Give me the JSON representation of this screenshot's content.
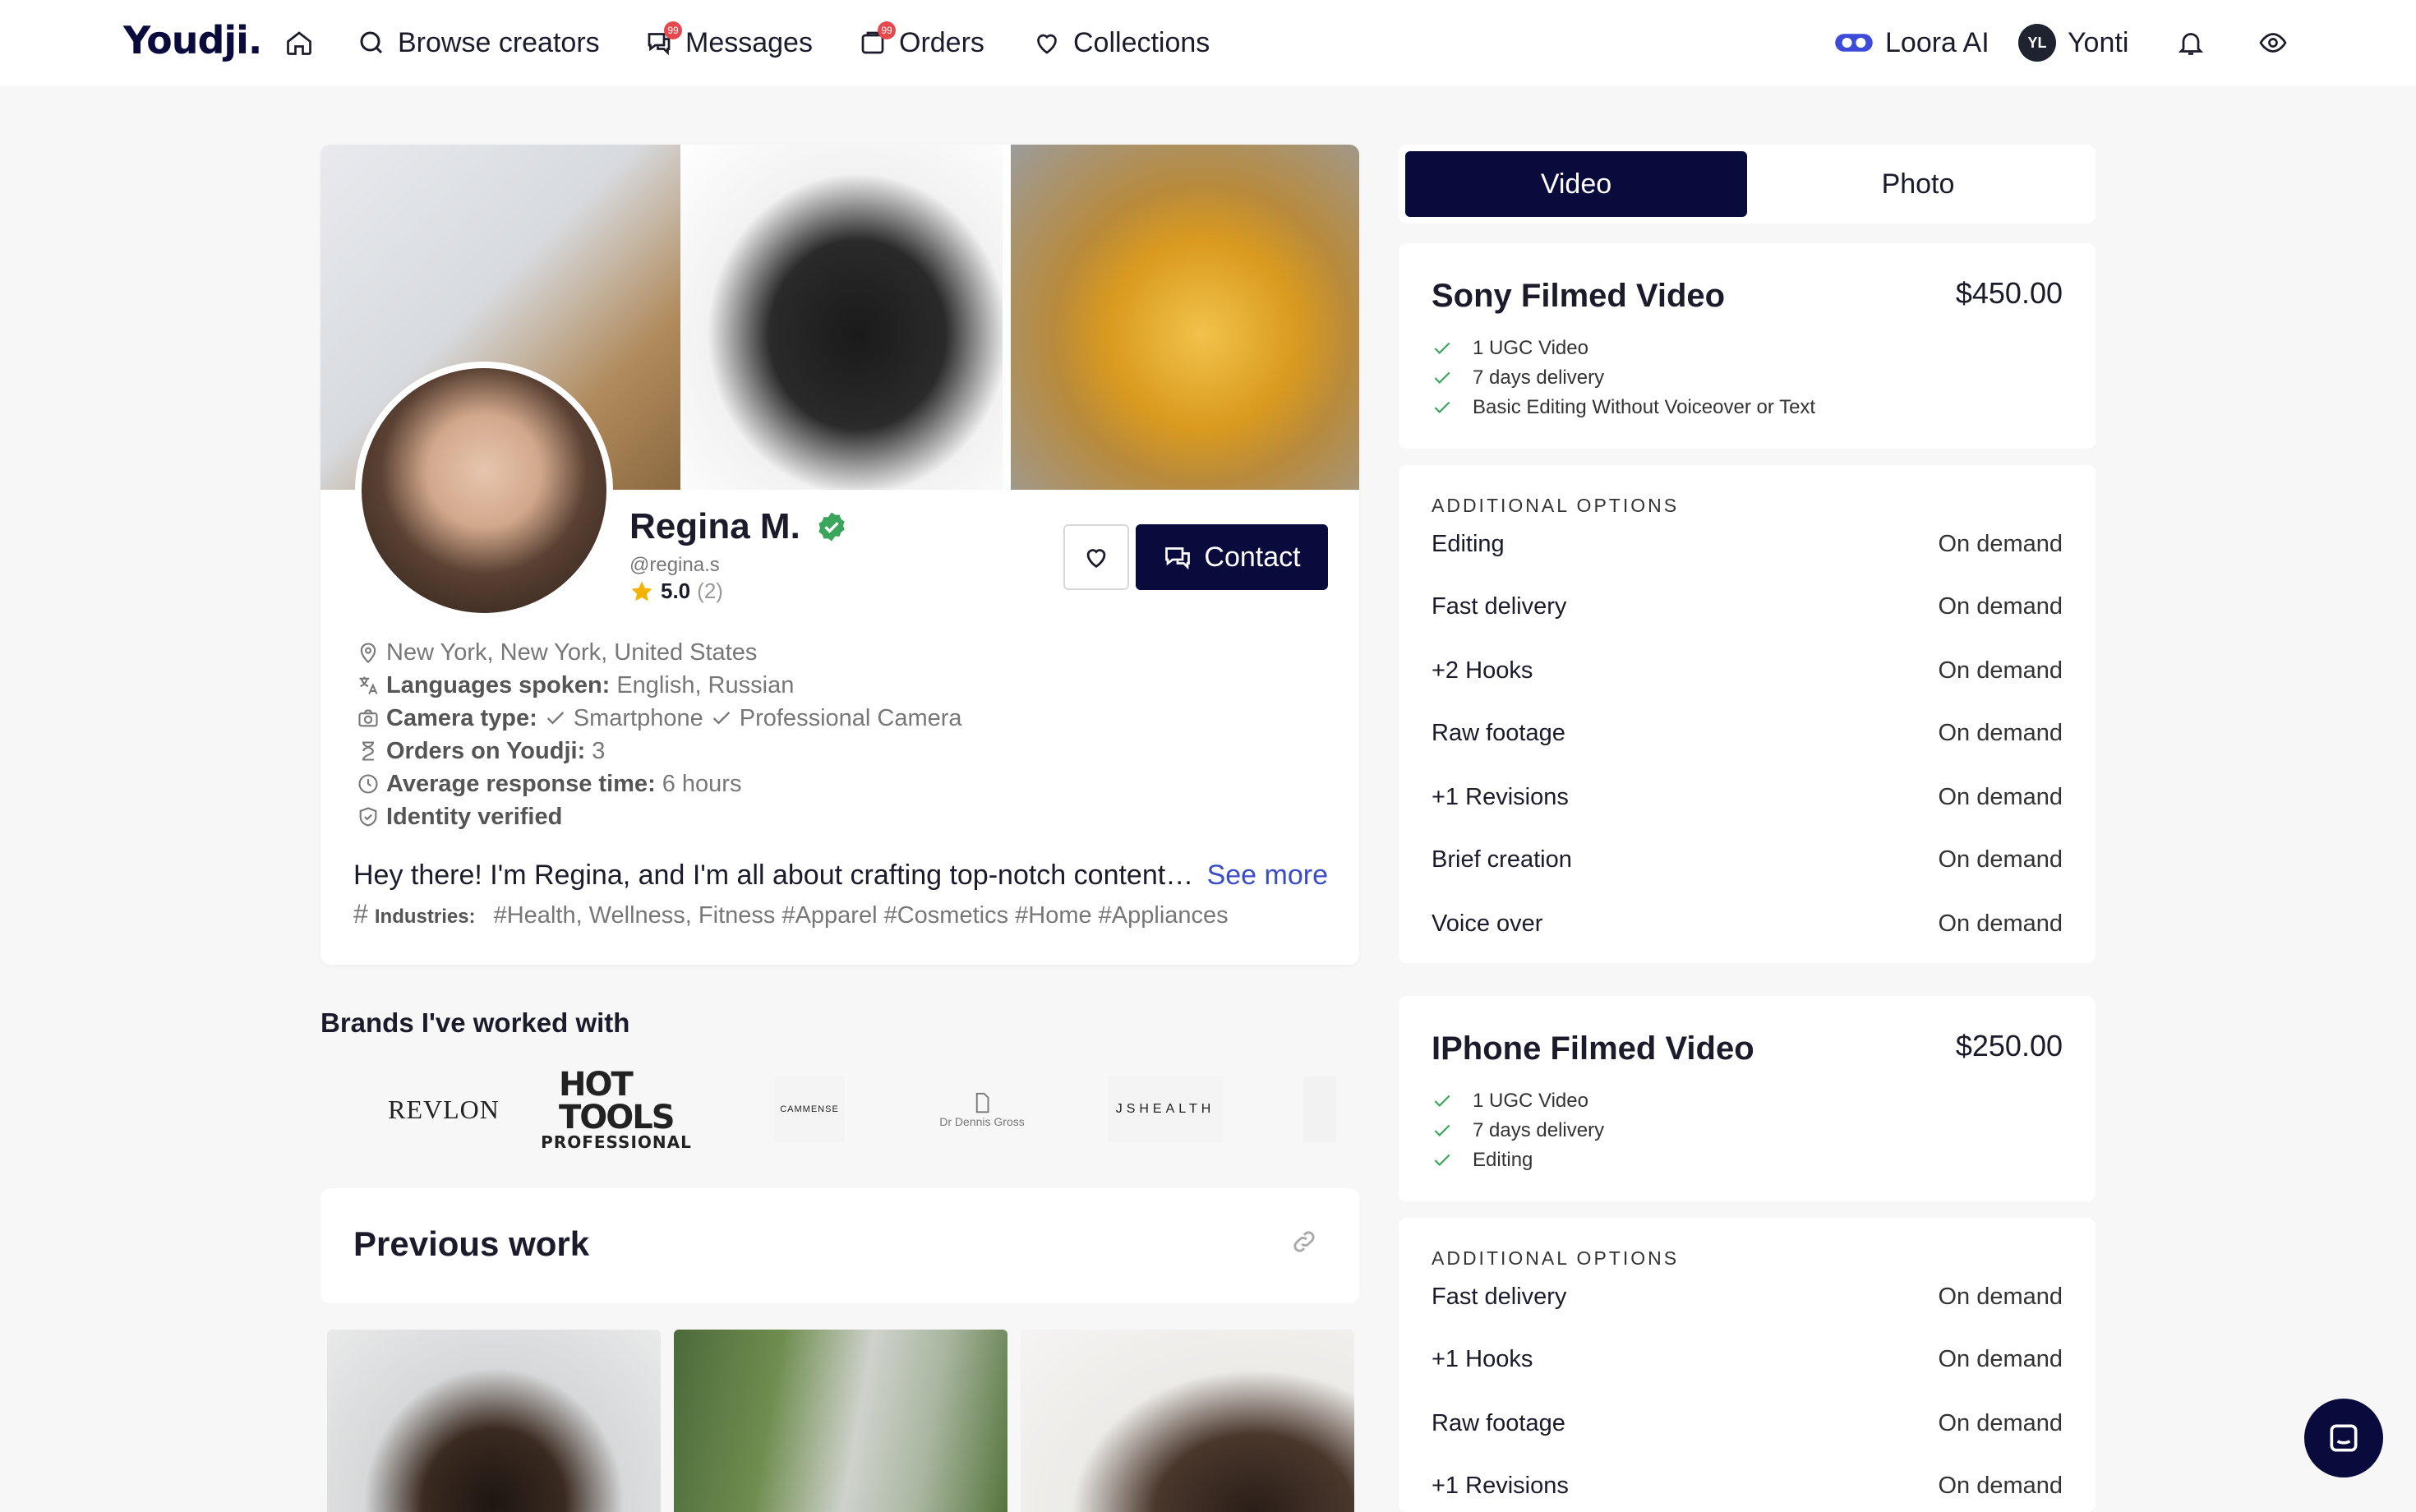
{
  "nav": {
    "logo": "Youdji.",
    "browse": "Browse creators",
    "messages": "Messages",
    "orders": "Orders",
    "collections": "Collections",
    "loora": "Loora AI",
    "user_initials": "YL",
    "user_name": "Yonti",
    "badge_count": "99"
  },
  "profile": {
    "name": "Regina M.",
    "handle": "@regina.s",
    "rating": "5.0",
    "rating_count": "(2)",
    "contact_label": "Contact",
    "location": "New York, New York, United States",
    "languages_label": "Languages spoken:",
    "languages": "English, Russian",
    "camera_label": "Camera type:",
    "camera_1": "Smartphone",
    "camera_2": "Professional Camera",
    "orders_label": "Orders on Youdji:",
    "orders_value": "3",
    "response_label": "Average response time:",
    "response_value": "6 hours",
    "identity": "Identity verified",
    "bio": "Hey there! I'm Regina, and I'm all about crafting top-notch content that tells your story",
    "see_more": "See more",
    "industries_label": "Industries:",
    "industries": "#Health, Wellness, Fitness #Apparel #Cosmetics #Home #Appliances"
  },
  "brands": {
    "title": "Brands I've worked with",
    "revlon": "REVLON",
    "hot_tools_1": "HOT TOOLS",
    "hot_tools_2": "PROFESSIONAL",
    "cammense": "CAMMENSE",
    "dr_dennis": "Dr Dennis Gross",
    "jshealth": "JSHEALTH"
  },
  "previous_work": {
    "title": "Previous work"
  },
  "tabs": {
    "video": "Video",
    "photo": "Photo"
  },
  "packages": [
    {
      "title": "Sony Filmed Video",
      "price": "$450.00",
      "features": [
        "1 UGC Video",
        "7 days delivery",
        "Basic Editing Without Voiceover or Text"
      ],
      "options_header": "ADDITIONAL OPTIONS",
      "options": [
        {
          "name": "Editing",
          "value": "On demand"
        },
        {
          "name": "Fast delivery",
          "value": "On demand"
        },
        {
          "name": "+2 Hooks",
          "value": "On demand"
        },
        {
          "name": "Raw footage",
          "value": "On demand"
        },
        {
          "name": "+1 Revisions",
          "value": "On demand"
        },
        {
          "name": "Brief creation",
          "value": "On demand"
        },
        {
          "name": "Voice over",
          "value": "On demand"
        }
      ]
    },
    {
      "title": "IPhone Filmed Video",
      "price": "$250.00",
      "features": [
        "1 UGC Video",
        "7 days delivery",
        "Editing"
      ],
      "options_header": "ADDITIONAL OPTIONS",
      "options": [
        {
          "name": "Fast delivery",
          "value": "On demand"
        },
        {
          "name": "+1 Hooks",
          "value": "On demand"
        },
        {
          "name": "Raw footage",
          "value": "On demand"
        },
        {
          "name": "+1 Revisions",
          "value": "On demand"
        }
      ]
    }
  ],
  "colors": {
    "brand_navy": "#0a0b3d",
    "verified_green": "#3aa65c",
    "link_blue": "#3a4cc7",
    "star": "#f5b301"
  }
}
